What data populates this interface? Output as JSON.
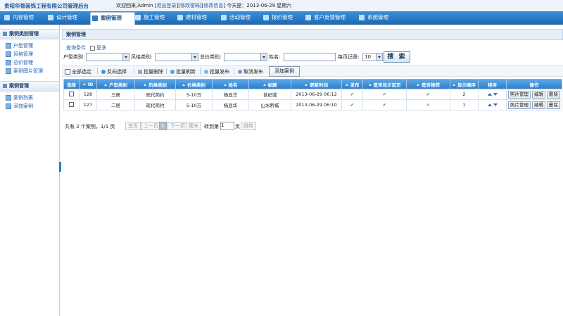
{
  "header": {
    "brand": "贵阳华胥装饰工程有限公司管理后台",
    "welcome_prefix": "欢迎回来,Admin [",
    "logout": "退出登录",
    "sep1": "][",
    "change_password": "修改密码",
    "sep2": "][",
    "change_info": "修改信息",
    "today": "] 今天是：2013-06-29 星期六"
  },
  "nav": [
    {
      "label": "内容管理"
    },
    {
      "label": "设计管理"
    },
    {
      "label": "案例管理"
    },
    {
      "label": "施工管理"
    },
    {
      "label": "建材管理"
    },
    {
      "label": "活动管理"
    },
    {
      "label": "报价管理"
    },
    {
      "label": "客户反馈管理"
    },
    {
      "label": "系统管理"
    }
  ],
  "sidebar": {
    "group1": "案例类别管理",
    "group1_items": [
      "户型管理",
      "风格管理",
      "总价管理",
      "案例图片管理"
    ],
    "group2": "案例管理",
    "group2_items": [
      "案例列表",
      "添加案例"
    ]
  },
  "main": {
    "title": "案例管理",
    "query_conditions": "查询条件",
    "more": "更多",
    "filters": {
      "type_label": "户型类别:",
      "style_label": "风格类别:",
      "price_label": "总价类别:",
      "name_label": "姓名:",
      "per_page_label": "每页记录:",
      "per_page_value": "10",
      "search": "搜 索"
    },
    "toolbar": {
      "select_all": "全部选定",
      "invert": "反向选择",
      "batch_delete": "批量删除",
      "batch_refresh": "批量刷新",
      "batch_publish": "批量发布",
      "cancel_publish": "取消发布",
      "add_case": "添加案例"
    },
    "columns": [
      "选择",
      "ID",
      "户型类别",
      "风格类别",
      "价格类别",
      "姓名",
      "标题",
      "更新时间",
      "发布",
      "是否显示首页",
      "是否推荐",
      "显示顺序",
      "排序",
      "操作"
    ],
    "rows": [
      {
        "id": "128",
        "type": "三居",
        "style": "现代简约",
        "price": "5-10万",
        "name": "杨显华",
        "title": "世纪城",
        "updated": "2013-06-29 06:12",
        "published": "✔",
        "homepage": "✔",
        "recommended": "✔",
        "order": "2"
      },
      {
        "id": "127",
        "type": "二居",
        "style": "现代简约",
        "price": "5-10万",
        "name": "杨显华",
        "title": "山水黔城",
        "updated": "2013-06-29 06:10",
        "published": "✔",
        "homepage": "✔",
        "recommended": "×",
        "order": "1"
      }
    ],
    "ops": {
      "photo": "照片管理",
      "edit": "编辑",
      "delete": "删除"
    },
    "pager": {
      "summary": "共有 2 个案例，1/1 页",
      "first": "首页",
      "prev": "上一页",
      "current": "1",
      "next": "下一页",
      "last": "尾末",
      "goto_label": "转到第",
      "goto_value": "1",
      "page_unit": "页",
      "jump": "跳转"
    }
  }
}
